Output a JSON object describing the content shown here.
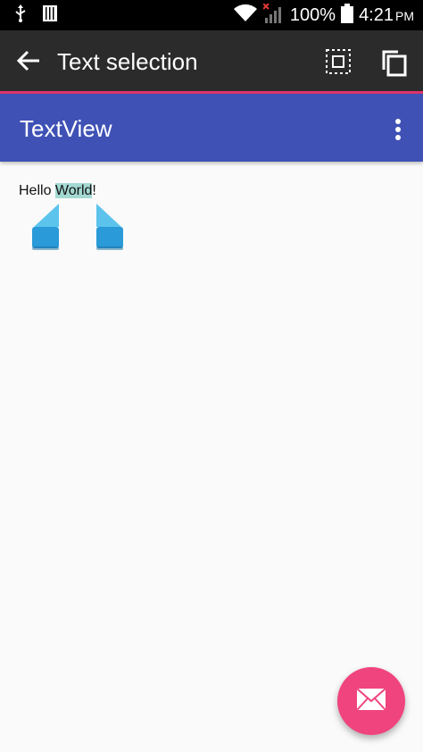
{
  "status_bar": {
    "battery_text": "100%",
    "time": "4:21",
    "ampm": "PM",
    "icons": [
      "usb-icon",
      "storage-icon",
      "wifi-icon",
      "signal-icon",
      "battery-icon"
    ]
  },
  "action_mode": {
    "title": "Text selection",
    "icons": [
      "back-arrow-icon",
      "select-all-icon",
      "copy-icon"
    ],
    "background": "#2b2b2b",
    "underline_color": "#e0356f"
  },
  "toolbar": {
    "title": "TextView",
    "background": "#3f51b5",
    "overflow_icon": "more-vert-icon"
  },
  "content": {
    "text_before": "Hello ",
    "text_selected": "World",
    "text_after": "!",
    "selection_color": "#a3d9d2",
    "handle_color": "#2a9ad8"
  },
  "fab": {
    "icon": "mail-icon",
    "color": "#f0447e"
  }
}
